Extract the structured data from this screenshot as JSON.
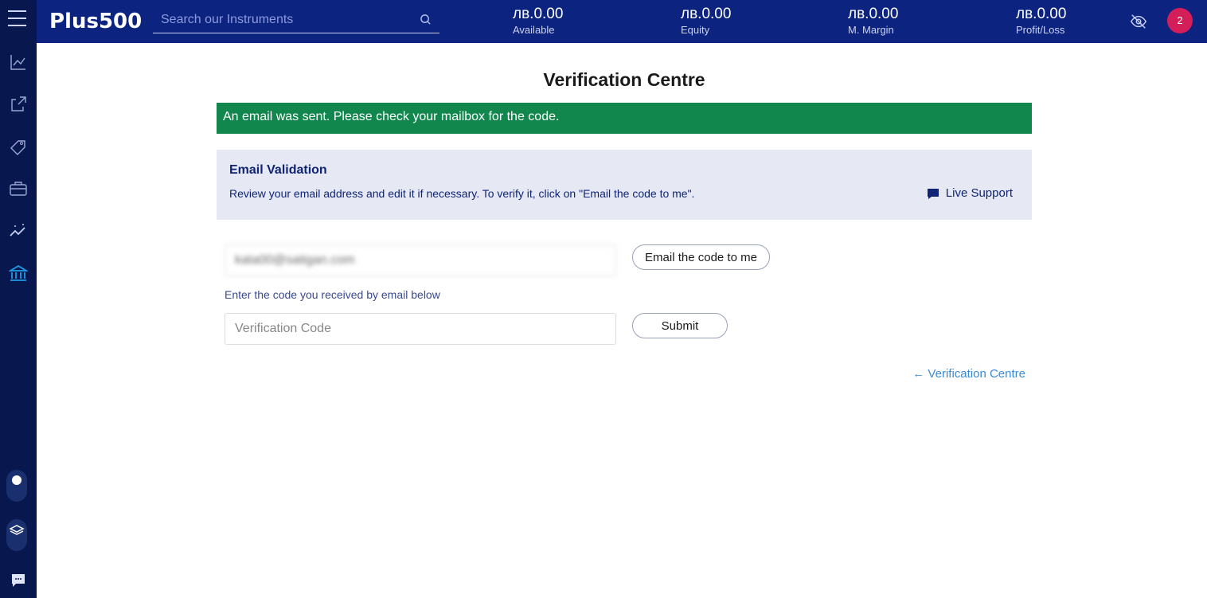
{
  "header": {
    "logo": "Plus500",
    "search_placeholder": "Search our Instruments",
    "stats": [
      {
        "value": "лв.0.00",
        "label": "Available"
      },
      {
        "value": "лв.0.00",
        "label": "Equity"
      },
      {
        "value": "лв.0.00",
        "label": "M. Margin"
      },
      {
        "value": "лв.0.00",
        "label": "Profit/Loss"
      }
    ],
    "notifications": "2"
  },
  "sidebar": {
    "items": [
      "chart-line-icon",
      "trade-icon",
      "tag-icon",
      "briefcase-icon",
      "insights-icon",
      "bank-icon"
    ],
    "active": "bank-icon",
    "accent": "#1e9be8"
  },
  "page": {
    "title": "Verification Centre",
    "alert": "An email was sent. Please check your mailbox for the code.",
    "panel_title": "Email Validation",
    "panel_text": "Review your email address and edit it if necessary. To verify it, click on \"Email the code to me\".",
    "live_support": "Live Support",
    "email_value": "kata00@satigan.com",
    "email_button": "Email the code to me",
    "hint": "Enter the code you received by email below",
    "code_placeholder": "Verification Code",
    "submit": "Submit",
    "back_link": "← Verification Centre"
  },
  "colors": {
    "topbar": "#0c2480",
    "sidebar": "#08184f",
    "alert": "#12874d",
    "panel": "#e6e9f3"
  }
}
